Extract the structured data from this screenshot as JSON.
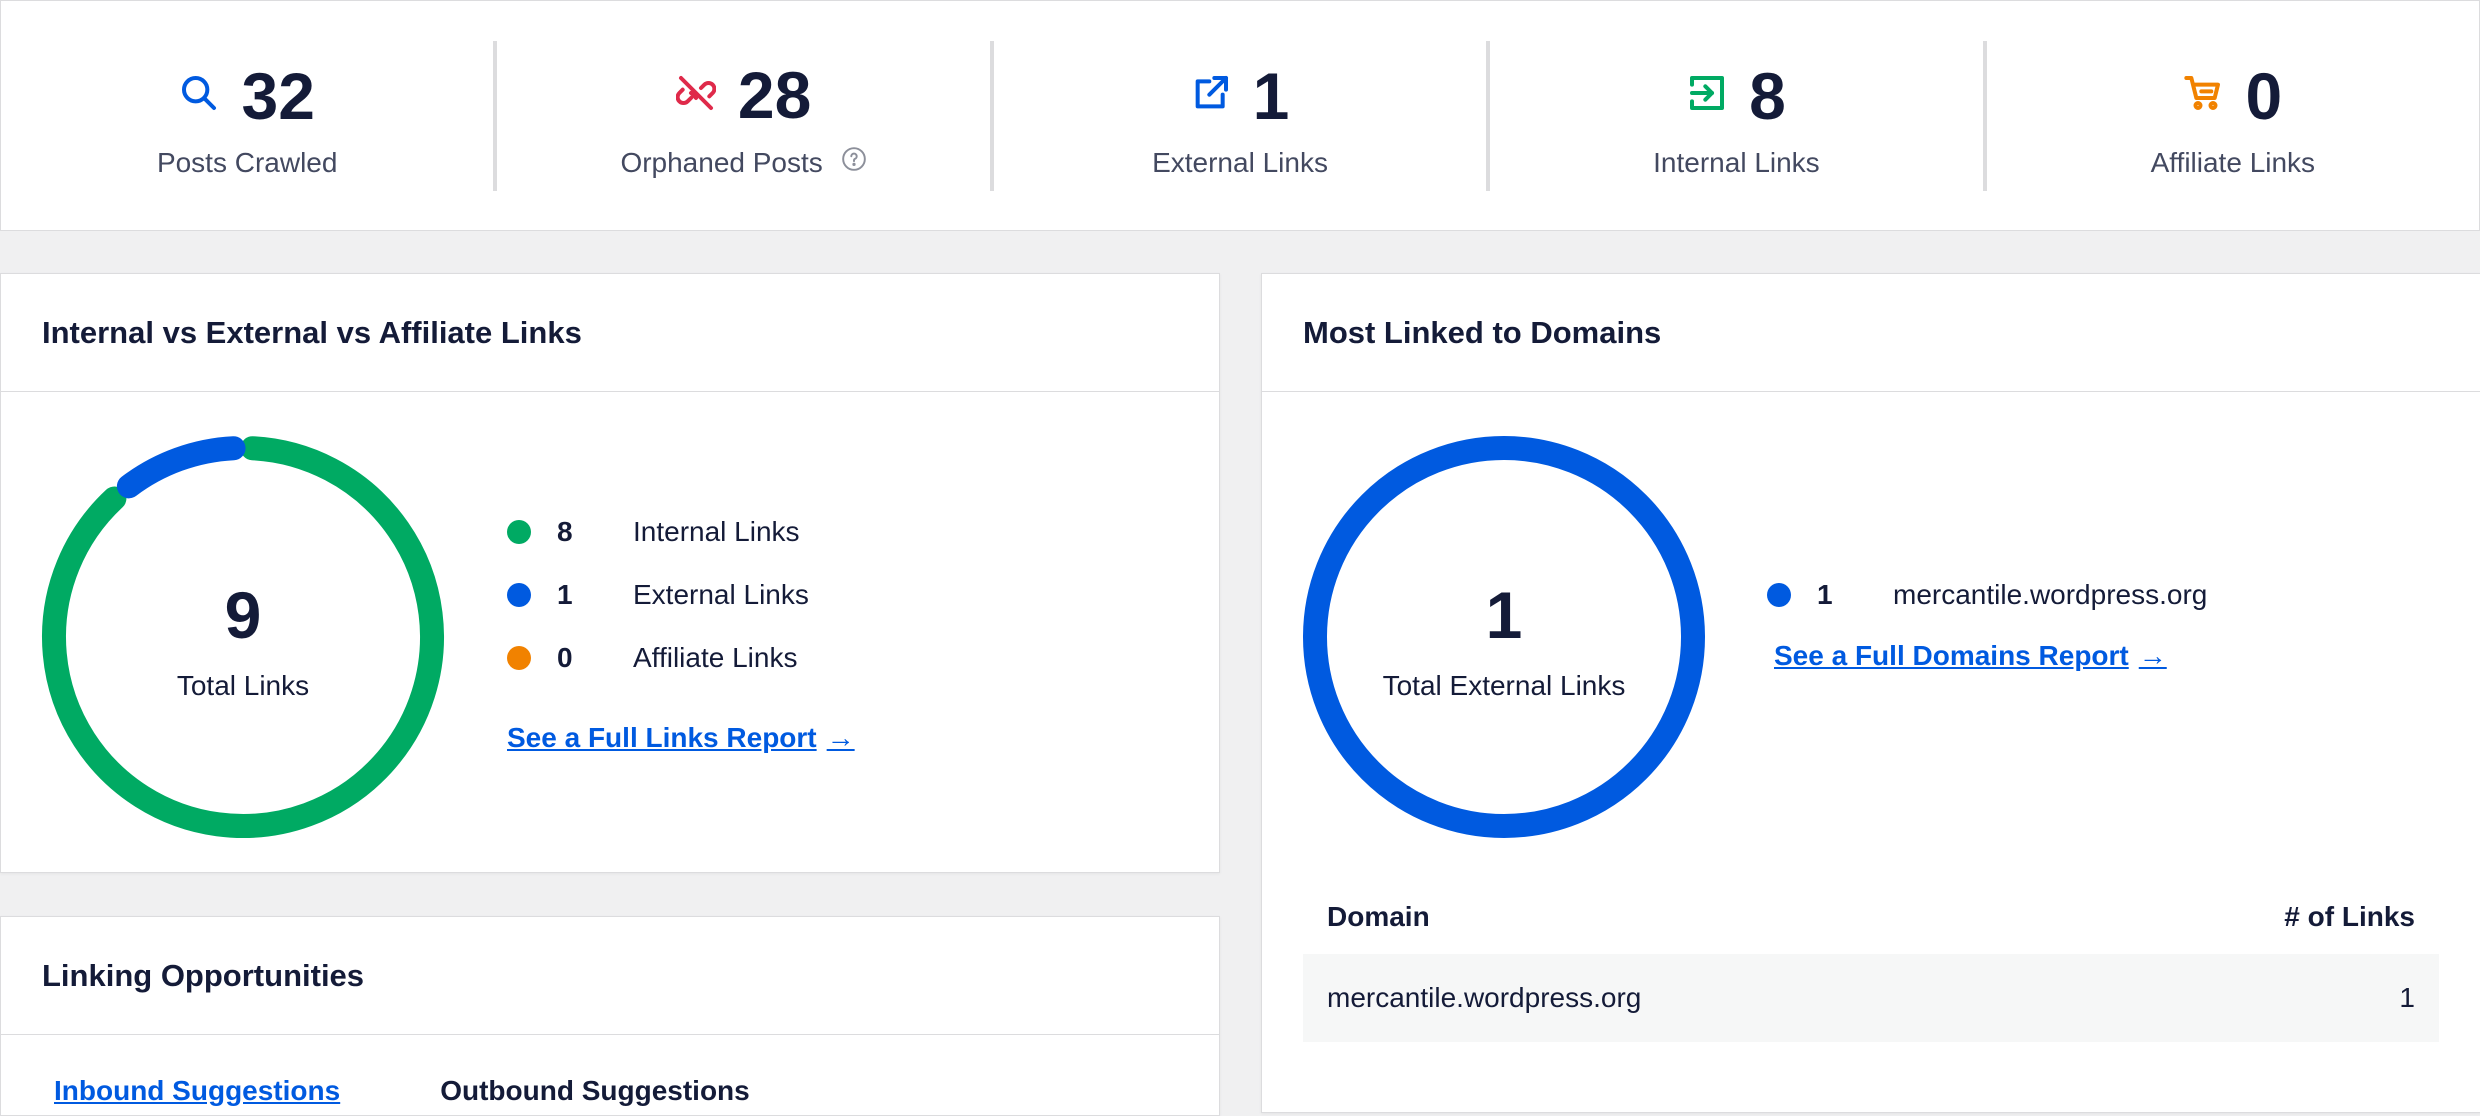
{
  "colors": {
    "internal": "#00aa63",
    "external": "#005ae0",
    "affiliate": "#f18200",
    "orphaned": "#df2a4a"
  },
  "stats": [
    {
      "icon": "search-icon",
      "value": "32",
      "label": "Posts Crawled"
    },
    {
      "icon": "broken-link-icon",
      "value": "28",
      "label": "Orphaned Posts"
    },
    {
      "icon": "external-link-icon",
      "value": "1",
      "label": "External Links"
    },
    {
      "icon": "internal-link-icon",
      "value": "8",
      "label": "Internal Links"
    },
    {
      "icon": "cart-icon",
      "value": "0",
      "label": "Affiliate Links"
    }
  ],
  "links_card": {
    "title": "Internal vs External vs Affiliate Links",
    "total": "9",
    "total_label": "Total Links",
    "legend": [
      {
        "count": "8",
        "label": "Internal Links"
      },
      {
        "count": "1",
        "label": "External Links"
      },
      {
        "count": "0",
        "label": "Affiliate Links"
      }
    ],
    "report_link": "See a Full Links Report"
  },
  "domains_card": {
    "title": "Most Linked to Domains",
    "total": "1",
    "total_label": "Total External Links",
    "legend": [
      {
        "count": "1",
        "label": "mercantile.wordpress.org"
      }
    ],
    "report_link": "See a Full Domains Report",
    "table": {
      "headers": [
        "Domain",
        "# of Links"
      ],
      "rows": [
        [
          "mercantile.wordpress.org",
          "1"
        ]
      ]
    }
  },
  "opps_card": {
    "title": "Linking Opportunities",
    "tabs": [
      "Inbound Suggestions",
      "Outbound Suggestions"
    ]
  },
  "chart_data": [
    {
      "type": "pie",
      "title": "Internal vs External vs Affiliate Links",
      "categories": [
        "Internal Links",
        "External Links",
        "Affiliate Links"
      ],
      "values": [
        8,
        1,
        0
      ]
    },
    {
      "type": "pie",
      "title": "Most Linked to Domains",
      "categories": [
        "mercantile.wordpress.org"
      ],
      "values": [
        1
      ]
    }
  ]
}
